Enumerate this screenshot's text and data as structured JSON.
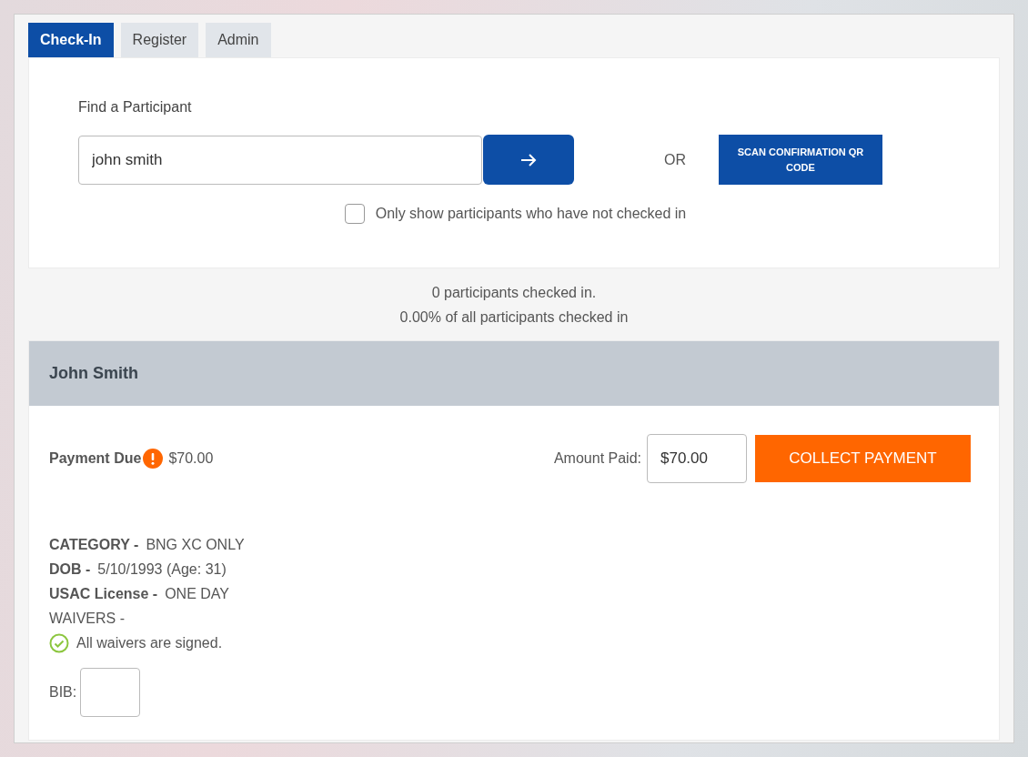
{
  "tabs": [
    {
      "label": "Check-In",
      "selected": true
    },
    {
      "label": "Register",
      "selected": false
    },
    {
      "label": "Admin",
      "selected": false
    }
  ],
  "search": {
    "label": "Find a Participant",
    "value": "john smith",
    "or_text": "OR",
    "scan_button": "SCAN CONFIRMATION QR CODE",
    "filter": {
      "label": "Only show participants who have not checked in",
      "checked": false
    }
  },
  "stats": [
    "0 participants checked in.",
    "0.00% of all participants checked in"
  ],
  "participant": {
    "name": "John Smith",
    "payment": {
      "label": "Payment Due",
      "due": true,
      "amount": "$70.00"
    },
    "amount_paid": {
      "label": "Amount Paid:",
      "value": "$70.00"
    },
    "collect_button": "COLLECT PAYMENT",
    "details": [
      {
        "label": "CATEGORY -",
        "value": "BNG XC ONLY"
      },
      {
        "label": "DOB -",
        "value": "5/10/1993 (Age: 31)"
      },
      {
        "label": "USAC License -",
        "value": "ONE DAY"
      }
    ],
    "waivers": {
      "label": "WAIVERS -",
      "signed": true,
      "status": "All waivers are signed."
    },
    "bib": {
      "label": "BIB:"
    }
  }
}
